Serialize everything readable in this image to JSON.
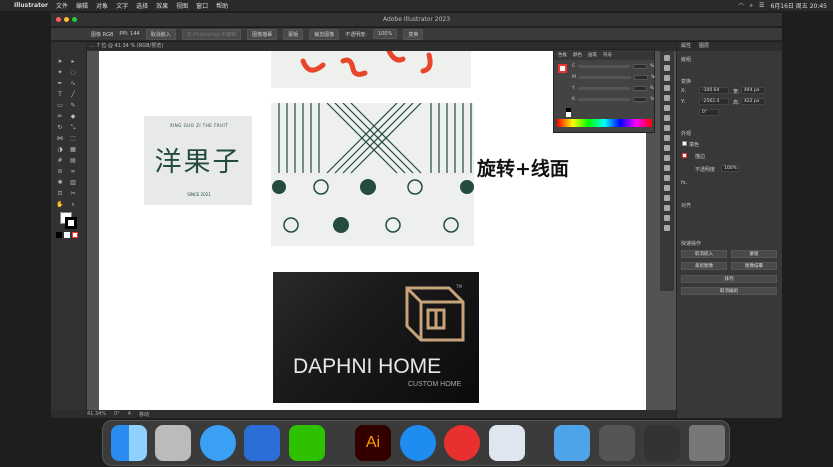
{
  "menubar": {
    "app_name": "Illustrator",
    "items": [
      "文件",
      "编辑",
      "对象",
      "文字",
      "选择",
      "效果",
      "视图",
      "窗口",
      "帮助"
    ],
    "datetime": "6月16日 周五 20:45"
  },
  "window": {
    "title": "Adobe Illustrator 2023"
  },
  "control_bar": {
    "mode": "图像 RGB",
    "ppi": "PPI: 144",
    "embed": "取消嵌入",
    "photoshop_edit": "在 Photoshop 中编辑",
    "image_trace": "图像描摹",
    "mask": "蒙版",
    "crop_image": "裁剪图像",
    "opacity_label": "不透明度:",
    "opacity_value": "100%",
    "transform": "变换"
  },
  "document_tab": "… 7 位 @ 41.34 % (RGB/预览)",
  "statusbar": {
    "zoom": "41.34%",
    "angle": "0°",
    "page": "4",
    "tool": "移动"
  },
  "artwork": {
    "heading": "旋转+线面",
    "logo_arc_text": "XING GUO ZI THE FRUIT",
    "logo_chars": "洋果子",
    "logo_sub": "SINCE 2021",
    "brand_name": "DAPHNI HOME",
    "brand_sub": "CUSTOM HOME",
    "tm": "TM"
  },
  "color_panel": {
    "tabs": [
      "色板",
      "颜色",
      "画笔",
      "符号"
    ],
    "channels": [
      "C",
      "M",
      "Y",
      "K"
    ],
    "unit": "%"
  },
  "properties_panel": {
    "tabs": [
      "属性",
      "图层"
    ],
    "section_embedded": "嵌组",
    "section_transform": "变换",
    "x_label": "X:",
    "x_value": "-100.64",
    "w_label": "宽:",
    "w_value": "444 px",
    "y_label": "Y:",
    "y_value": "-2562.4",
    "h_label": "高:",
    "h_value": "422 px",
    "angle_value": "0°",
    "section_appearance": "外观",
    "fill_label": "填色",
    "stroke_label": "描边",
    "opacity_label": "不透明度",
    "opacity_value": "100%",
    "fx_label": "fx.",
    "section_align": "对齐",
    "section_quick": "快速操作",
    "btn_unembed": "取消嵌入",
    "btn_mask": "蒙版",
    "btn_crop": "裁剪图像",
    "btn_trace": "图像描摹",
    "btn_arrange": "排列",
    "btn_ungroup": "取消编组"
  },
  "colors": {
    "accent_orange": "#e8452a",
    "dark_teal": "#234b3f",
    "logo_bg": "#e8eae8",
    "pattern_bg": "#eef0ee",
    "gold_box": "#c7a27a"
  },
  "dock_icons": [
    "finder-icon",
    "launchpad-icon",
    "safari-icon",
    "surf-icon",
    "wechat-icon",
    "illustrator-icon",
    "qq-icon",
    "netease-music-icon",
    "preview-icon",
    "folder-icon",
    "screenshot-icon",
    "stack-icon",
    "trash-icon"
  ]
}
